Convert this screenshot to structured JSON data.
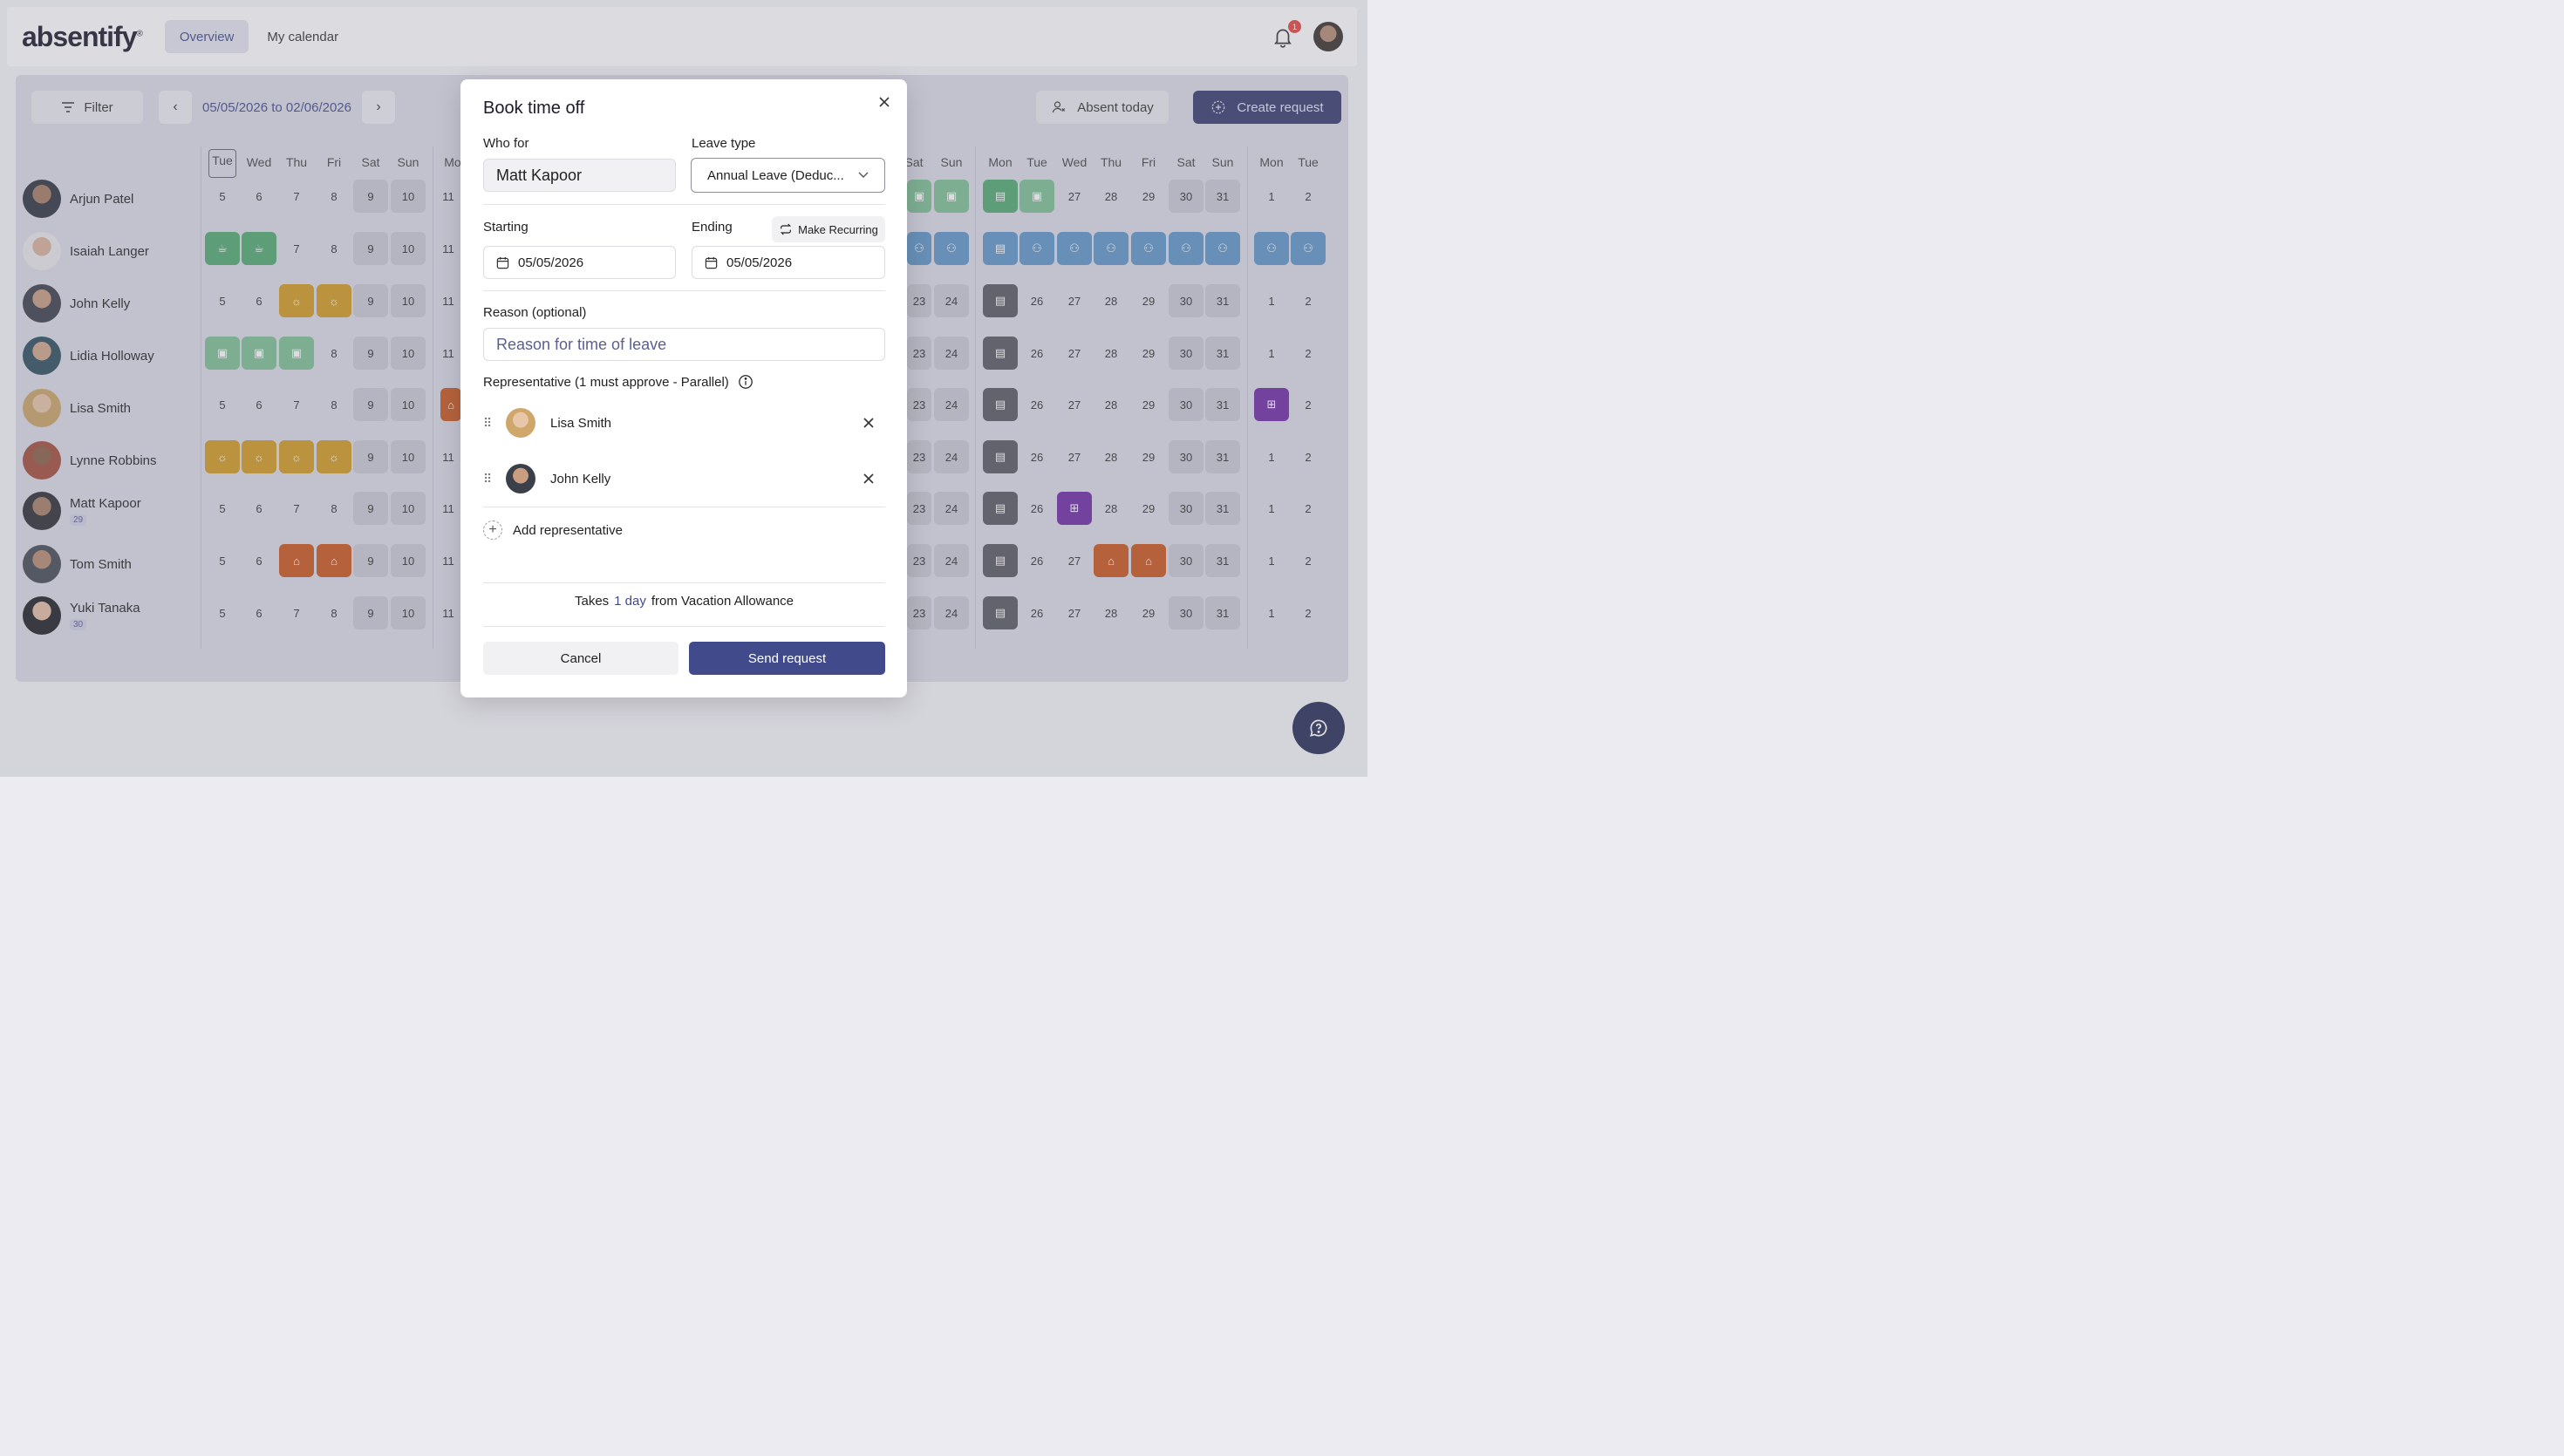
{
  "header": {
    "logo": "absentify",
    "tabs": [
      {
        "label": "Overview"
      },
      {
        "label": "My calendar"
      }
    ],
    "notification_count": "1"
  },
  "toolbar": {
    "filter_label": "Filter",
    "date_range": "05/05/2026 to 02/06/2026",
    "absent_today_label": "Absent today",
    "create_request_label": "Create request"
  },
  "calendar": {
    "left_days": [
      "Tue",
      "Wed",
      "Thu",
      "Fri",
      "Sat",
      "Sun",
      "Mo"
    ],
    "right_days": [
      "Sat",
      "Sun",
      "Mon",
      "Tue",
      "Wed",
      "Thu",
      "Fri",
      "Sat",
      "Sun",
      "Mon",
      "Tue"
    ],
    "employees": [
      {
        "name": "Arjun Patel",
        "badge": ""
      },
      {
        "name": "Isaiah Langer",
        "badge": ""
      },
      {
        "name": "John Kelly",
        "badge": ""
      },
      {
        "name": "Lidia Holloway",
        "badge": ""
      },
      {
        "name": "Lisa Smith",
        "badge": ""
      },
      {
        "name": "Lynne Robbins",
        "badge": ""
      },
      {
        "name": "Matt Kapoor",
        "badge": "29"
      },
      {
        "name": "Tom Smith",
        "badge": ""
      },
      {
        "name": "Yuki Tanaka",
        "badge": "30"
      }
    ],
    "left_numbers": [
      "5",
      "6",
      "7",
      "8",
      "9",
      "10",
      "11"
    ],
    "right_numbers_a": [
      "23",
      "24",
      "",
      "26",
      "27",
      "28",
      "29",
      "30",
      "31",
      "1",
      "2"
    ],
    "right_numbers_b": [
      "",
      "",
      "",
      "",
      "27",
      "28",
      "29",
      "30",
      "31",
      "1",
      "2"
    ]
  },
  "modal": {
    "title": "Book time off",
    "who_for_label": "Who for",
    "who_for_value": "Matt Kapoor",
    "leave_type_label": "Leave type",
    "leave_type_value": "Annual Leave (Deduc...",
    "starting_label": "Starting",
    "starting_value": "05/05/2026",
    "ending_label": "Ending",
    "ending_value": "05/05/2026",
    "make_recurring_label": "Make Recurring",
    "reason_label": "Reason (optional)",
    "reason_placeholder": "Reason for time of leave",
    "representative_label": "Representative (1 must approve - Parallel)",
    "representatives": [
      {
        "name": "Lisa Smith"
      },
      {
        "name": "John Kelly"
      }
    ],
    "add_representative_label": "Add representative",
    "takes_prefix": "Takes",
    "takes_amount": "1 day",
    "takes_suffix": "from Vacation Allowance",
    "cancel_label": "Cancel",
    "send_label": "Send request"
  },
  "colors": {
    "accent": "#414a8a",
    "create_button": "#353a6d",
    "notification_badge": "#e5443f"
  }
}
